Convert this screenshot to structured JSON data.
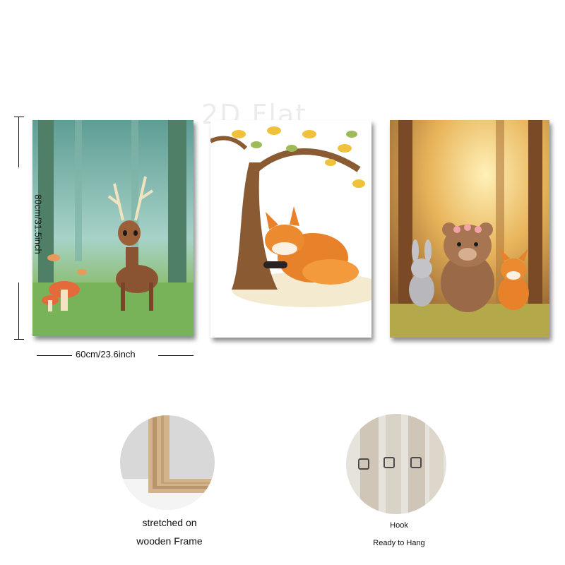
{
  "watermark": "2D Flat",
  "dimensions": {
    "width_label": "60cm/23.6inch",
    "height_label": "80cm/31.5inch"
  },
  "artworks": [
    {
      "subject": "deer in enchanted forest with mushrooms"
    },
    {
      "subject": "sleeping fox under autumn tree"
    },
    {
      "subject": "bear with flower crown, bunny and fox in sunlit forest"
    }
  ],
  "features": [
    {
      "line1": "stretched on",
      "line2": "wooden Frame",
      "icon": "wooden-frame-photo"
    },
    {
      "line1": "Hook",
      "line2": "Ready to Hang",
      "icon": "hook-photo"
    }
  ],
  "colors": {
    "forest_teal": "#7fb8ae",
    "autumn_orange": "#e8822a",
    "sunlight_gold": "#e8b45a"
  }
}
